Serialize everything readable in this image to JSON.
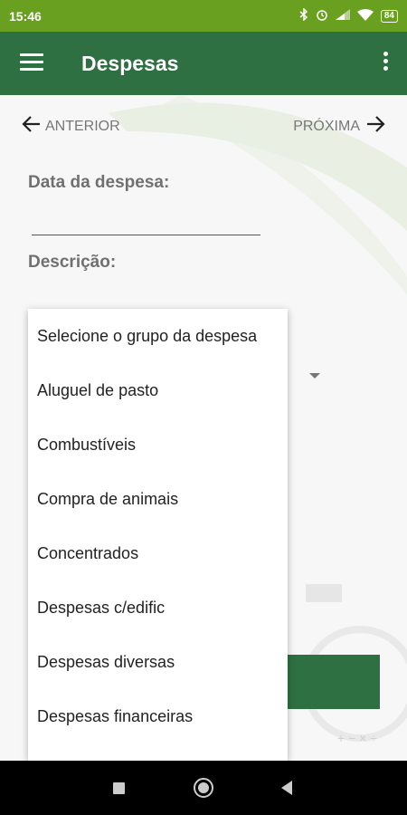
{
  "status_bar": {
    "time": "15:46",
    "battery": "84"
  },
  "app_bar": {
    "title": "Despesas"
  },
  "navigation": {
    "previous": "ANTERIOR",
    "next": "PRÓXIMA"
  },
  "form": {
    "date_label": "Data da despesa:",
    "description_label": "Descrição:"
  },
  "dropdown": {
    "items": [
      "Selecione o grupo da despesa",
      "Aluguel de pasto",
      "Combustíveis",
      "Compra de animais",
      "Concentrados",
      "Despesas c/edific",
      "Despesas diversas",
      "Despesas financeiras"
    ]
  },
  "colors": {
    "status_bar": "#6aa01f",
    "app_bar": "#2e7042",
    "label_text": "#707070"
  },
  "icons": [
    "bluetooth-icon",
    "alarm-icon",
    "signal-icon",
    "wifi-icon",
    "battery-icon",
    "menu-icon",
    "overflow-menu-icon",
    "arrow-left-icon",
    "arrow-right-icon",
    "dropdown-arrow-icon"
  ]
}
